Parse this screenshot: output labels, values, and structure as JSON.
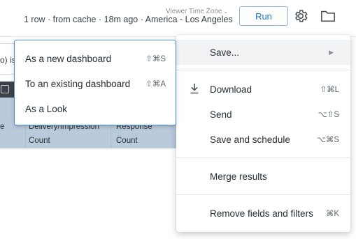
{
  "header": {
    "status": "1 row · from cache · 18m ago · America - Los Angeles",
    "timezone_label": "Viewer Time Zone",
    "timezone_chevron": "⌄",
    "run_label": "Run",
    "icons": [
      "gear-icon",
      "folder-icon"
    ]
  },
  "background": {
    "info_text": "o) is",
    "table_headers": [
      "e",
      "Delivery/Impression Count",
      "Response Count"
    ]
  },
  "submenu": {
    "items": [
      {
        "label": "As a new dashboard",
        "shortcut": "⇧⌘S"
      },
      {
        "label": "To an existing dashboard",
        "shortcut": "⇧⌘A"
      },
      {
        "label": "As a Look",
        "shortcut": ""
      }
    ]
  },
  "menu": {
    "save": {
      "label": "Save...",
      "arrow": "▶"
    },
    "download": {
      "label": "Download",
      "shortcut": "⇧⌘L"
    },
    "send": {
      "label": "Send",
      "shortcut": "⌥⇧S"
    },
    "save_schedule": {
      "label": "Save and schedule",
      "shortcut": "⌥⌘S"
    },
    "merge": {
      "label": "Merge results"
    },
    "remove": {
      "label": "Remove fields and filters",
      "shortcut": "⌘K"
    }
  },
  "colors": {
    "accent": "#1a73c8",
    "table_header": "#b9cadb",
    "dark_toolbar": "#3c4248",
    "hover": "#f1f3f5"
  }
}
